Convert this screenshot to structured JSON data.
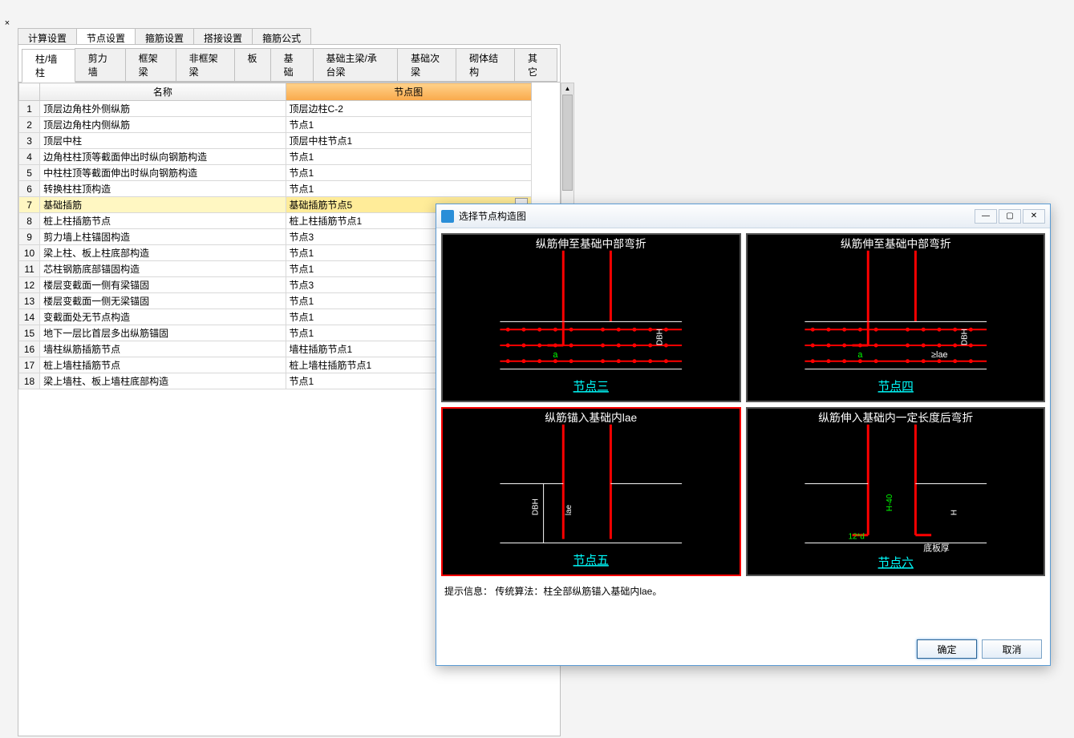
{
  "close_x": "×",
  "top_tabs": [
    "计算设置",
    "节点设置",
    "箍筋设置",
    "搭接设置",
    "箍筋公式"
  ],
  "top_active": 1,
  "sub_tabs": [
    "柱/墙柱",
    "剪力墙",
    "框架梁",
    "非框架梁",
    "板",
    "基础",
    "基础主梁/承台梁",
    "基础次梁",
    "砌体结构",
    "其它"
  ],
  "sub_active": 0,
  "grid": {
    "head_name": "名称",
    "head_node": "节点图",
    "rows": [
      {
        "i": "1",
        "name": "顶层边角柱外侧纵筋",
        "node": "顶层边柱C-2"
      },
      {
        "i": "2",
        "name": "顶层边角柱内侧纵筋",
        "node": "节点1"
      },
      {
        "i": "3",
        "name": "顶层中柱",
        "node": "顶层中柱节点1"
      },
      {
        "i": "4",
        "name": "边角柱柱顶等截面伸出时纵向钢筋构造",
        "node": "节点1"
      },
      {
        "i": "5",
        "name": "中柱柱顶等截面伸出时纵向钢筋构造",
        "node": "节点1"
      },
      {
        "i": "6",
        "name": "转换柱柱顶构造",
        "node": "节点1"
      },
      {
        "i": "7",
        "name": "基础插筋",
        "node": "基础插筋节点5",
        "sel": true
      },
      {
        "i": "8",
        "name": "桩上柱插筋节点",
        "node": "桩上柱插筋节点1"
      },
      {
        "i": "9",
        "name": "剪力墙上柱锚固构造",
        "node": "节点3"
      },
      {
        "i": "10",
        "name": "梁上柱、板上柱底部构造",
        "node": "节点1"
      },
      {
        "i": "11",
        "name": "芯柱钢筋底部锚固构造",
        "node": "节点1"
      },
      {
        "i": "12",
        "name": "楼层变截面一侧有梁锚固",
        "node": "节点3"
      },
      {
        "i": "13",
        "name": "楼层变截面一侧无梁锚固",
        "node": "节点1"
      },
      {
        "i": "14",
        "name": "变截面处无节点构造",
        "node": "节点1"
      },
      {
        "i": "15",
        "name": "地下一层比首层多出纵筋锚固",
        "node": "节点1"
      },
      {
        "i": "16",
        "name": "墙柱纵筋插筋节点",
        "node": "墙柱插筋节点1"
      },
      {
        "i": "17",
        "name": "桩上墙柱插筋节点",
        "node": "桩上墙柱插筋节点1"
      },
      {
        "i": "18",
        "name": "梁上墙柱、板上墙柱底部构造",
        "node": "节点1"
      }
    ],
    "more": "…"
  },
  "dialog": {
    "title": "选择节点构造图",
    "min": "—",
    "max": "▢",
    "close": "✕",
    "thumbs": [
      {
        "title": "纵筋伸至基础中部弯折",
        "label": "节点三",
        "a": "a",
        "dbh": "DBH"
      },
      {
        "title": "纵筋伸至基础中部弯折",
        "label": "节点四",
        "a": "a",
        "dbh": "DBH",
        "lae": "≥lae"
      },
      {
        "title": "纵筋锚入基础内lae",
        "label": "节点五",
        "dbh": "DBH",
        "lae": "lae",
        "sel": true
      },
      {
        "title": "纵筋伸入基础内一定长度后弯折",
        "label": "节点六",
        "d12": "12*d",
        "h40": "H-40",
        "h": "H",
        "bt": "底板厚"
      }
    ],
    "hint": "提示信息： 传统算法：柱全部纵筋锚入基础内lae。",
    "ok": "确定",
    "cancel": "取消"
  }
}
